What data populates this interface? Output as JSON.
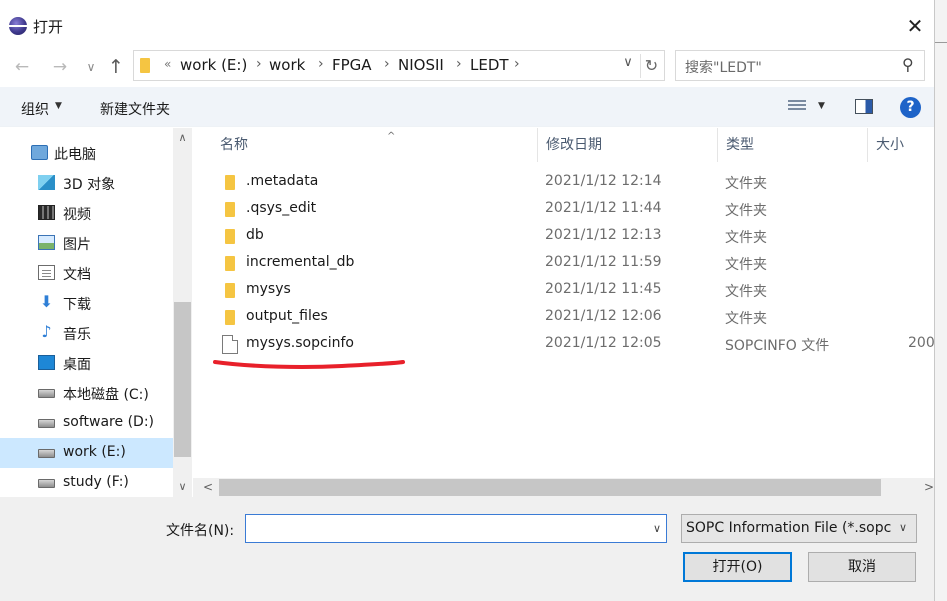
{
  "window": {
    "title": "打开",
    "close_glyph": "✕"
  },
  "nav": {
    "back_glyph": "←",
    "forward_glyph": "→",
    "recent_glyph": "∨",
    "up_glyph": "↑",
    "breadcrumb_prefix": "«",
    "breadcrumbs": [
      "work (E:)",
      "work",
      "FPGA",
      "NIOSII",
      "LEDT"
    ],
    "separator": "›",
    "dropdown_glyph": "∨",
    "refresh_glyph": "↻"
  },
  "search": {
    "placeholder": "搜索\"LEDT\"",
    "icon_glyph": "⚲"
  },
  "toolbar": {
    "organize_label": "组织",
    "organize_arrow": "▼",
    "new_folder_label": "新建文件夹",
    "view_arrow": "▼",
    "help_glyph": "?"
  },
  "sidebar": {
    "items": [
      {
        "label": "此电脑",
        "icon": "computer-icon"
      },
      {
        "label": "3D 对象",
        "icon": "3d-objects-icon"
      },
      {
        "label": "视频",
        "icon": "video-icon"
      },
      {
        "label": "图片",
        "icon": "pictures-icon"
      },
      {
        "label": "文档",
        "icon": "documents-icon"
      },
      {
        "label": "下载",
        "icon": "download-icon"
      },
      {
        "label": "音乐",
        "icon": "music-icon"
      },
      {
        "label": "桌面",
        "icon": "desktop-icon"
      },
      {
        "label": "本地磁盘 (C:)",
        "icon": "system-drive-icon"
      },
      {
        "label": "software (D:)",
        "icon": "drive-icon"
      },
      {
        "label": "work (E:)",
        "icon": "drive-icon",
        "selected": true
      },
      {
        "label": "study (F:)",
        "icon": "drive-icon"
      }
    ],
    "download_glyph": "⬇",
    "music_glyph": "♪",
    "scroll_up_glyph": "∧",
    "scroll_down_glyph": "∨"
  },
  "columns": {
    "name": "名称",
    "date": "修改日期",
    "type": "类型",
    "size": "大小",
    "sort_glyph": "^"
  },
  "files": [
    {
      "name": ".metadata",
      "date": "2021/1/12 12:14",
      "type": "文件夹",
      "size": "",
      "kind": "folder"
    },
    {
      "name": ".qsys_edit",
      "date": "2021/1/12 11:44",
      "type": "文件夹",
      "size": "",
      "kind": "folder"
    },
    {
      "name": "db",
      "date": "2021/1/12 12:13",
      "type": "文件夹",
      "size": "",
      "kind": "folder"
    },
    {
      "name": "incremental_db",
      "date": "2021/1/12 11:59",
      "type": "文件夹",
      "size": "",
      "kind": "folder"
    },
    {
      "name": "mysys",
      "date": "2021/1/12 11:45",
      "type": "文件夹",
      "size": "",
      "kind": "folder"
    },
    {
      "name": "output_files",
      "date": "2021/1/12 12:06",
      "type": "文件夹",
      "size": "",
      "kind": "folder"
    },
    {
      "name": "mysys.sopcinfo",
      "date": "2021/1/12 12:05",
      "type": "SOPCINFO 文件",
      "size": "200",
      "kind": "file"
    }
  ],
  "hscroll": {
    "left_glyph": "<",
    "right_glyph": ">"
  },
  "footer": {
    "filename_label": "文件名(N):",
    "filename_value": "",
    "filename_dropdown_glyph": "∨",
    "filter_value": "SOPC Information File (*.sopcinfo)",
    "filter_dropdown_glyph": "∨",
    "open_label": "打开(O)",
    "cancel_label": "取消"
  },
  "colors": {
    "selection": "#cce8ff",
    "accent": "#0078d7",
    "annotation": "#e8202a",
    "folder": "#f5c542"
  }
}
